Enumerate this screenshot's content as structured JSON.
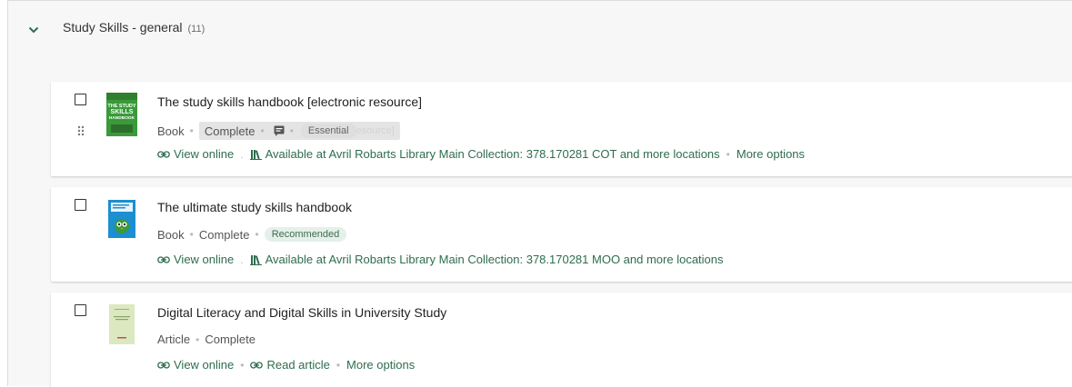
{
  "section": {
    "title": "Study Skills - general",
    "count": "(11)"
  },
  "items": [
    {
      "title": "The study skills handbook [electronic resource]",
      "type": "Book",
      "status": "Complete",
      "importance": "Essential",
      "overflow_text": "esource]",
      "view_online": "View online",
      "availability": "Available at Avril Robarts Library Main Collection: 378.170281 COT and more locations",
      "more_options": "More options",
      "cover": {
        "title_lines": [
          "THE STUDY",
          "SKILLS",
          "HANDBOOK"
        ],
        "color": "#3a9a3a"
      }
    },
    {
      "title": "The ultimate study skills handbook",
      "type": "Book",
      "status": "Complete",
      "importance": "Recommended",
      "view_online": "View online",
      "availability": "Available at Avril Robarts Library Main Collection: 378.170281 MOO and more locations",
      "cover": {
        "color": "#1c8fd0"
      }
    },
    {
      "title": "Digital Literacy and Digital Skills in University Study",
      "type": "Article",
      "status": "Complete",
      "view_online": "View online",
      "read_article": "Read article",
      "more_options": "More options",
      "cover": {
        "color": "#dce8c0"
      }
    }
  ],
  "colors": {
    "link": "#2e6d4f",
    "background": "#f7f7f7",
    "card": "#ffffff"
  }
}
